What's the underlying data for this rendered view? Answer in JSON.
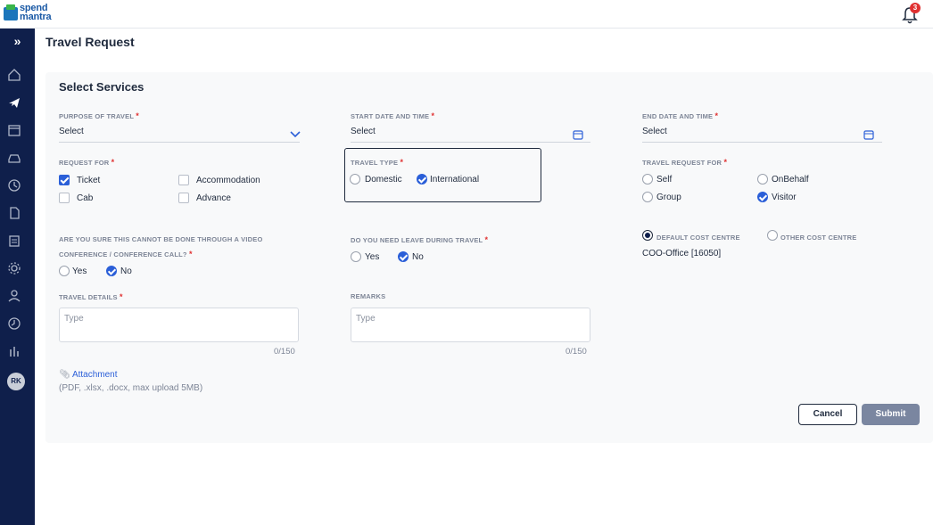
{
  "brand": {
    "line1": "spend",
    "line2": "mantra"
  },
  "notifications": {
    "count": "3"
  },
  "sidebar": {
    "toggle": "»",
    "avatar_initials": "RK"
  },
  "page": {
    "title": "Travel Request"
  },
  "section": {
    "title": "Select Services"
  },
  "purpose": {
    "label": "PURPOSE OF TRAVEL",
    "value": "Select"
  },
  "start": {
    "label": "START DATE AND TIME",
    "value": "Select"
  },
  "end": {
    "label": "END DATE AND TIME",
    "value": "Select"
  },
  "request_for": {
    "label": "REQUEST FOR",
    "options": [
      {
        "label": "Ticket",
        "checked": true
      },
      {
        "label": "Accommodation",
        "checked": false
      },
      {
        "label": "Cab",
        "checked": false
      },
      {
        "label": "Advance",
        "checked": false
      }
    ]
  },
  "travel_type": {
    "label": "TRAVEL TYPE",
    "options": [
      {
        "label": "Domestic",
        "selected": false
      },
      {
        "label": "International",
        "selected": true
      }
    ]
  },
  "travel_request_for": {
    "label": "TRAVEL REQUEST FOR",
    "options": [
      {
        "label": "Self",
        "selected": false
      },
      {
        "label": "OnBehalf",
        "selected": false
      },
      {
        "label": "Group",
        "selected": false
      },
      {
        "label": "Visitor",
        "selected": true
      }
    ]
  },
  "video_conf": {
    "label_line1": "ARE YOU SURE THIS CANNOT BE DONE THROUGH A VIDEO",
    "label_line2": "CONFERENCE / CONFERENCE CALL?",
    "options": [
      {
        "label": "Yes",
        "selected": false
      },
      {
        "label": "No",
        "selected": true
      }
    ]
  },
  "leave": {
    "label": "DO YOU NEED LEAVE DURING TRAVEL",
    "options": [
      {
        "label": "Yes",
        "selected": false
      },
      {
        "label": "No",
        "selected": true
      }
    ]
  },
  "cost_centre": {
    "options": [
      {
        "label": "DEFAULT COST CENTRE",
        "selected": true
      },
      {
        "label": "OTHER COST CENTRE",
        "selected": false
      }
    ],
    "value": "COO-Office [16050]"
  },
  "travel_details": {
    "label": "TRAVEL DETAILS",
    "placeholder": "Type",
    "counter": "0/150"
  },
  "remarks": {
    "label": "REMARKS",
    "placeholder": "Type",
    "counter": "0/150"
  },
  "attachment": {
    "label": "Attachment",
    "hint": "(PDF, .xlsx, .docx, max upload 5MB)"
  },
  "actions": {
    "cancel": "Cancel",
    "submit": "Submit"
  },
  "colors": {
    "sidebar": "#0f1f4b",
    "accent": "#2b5fd8",
    "required": "#e03131",
    "submit_disabled": "#7a86a0"
  }
}
